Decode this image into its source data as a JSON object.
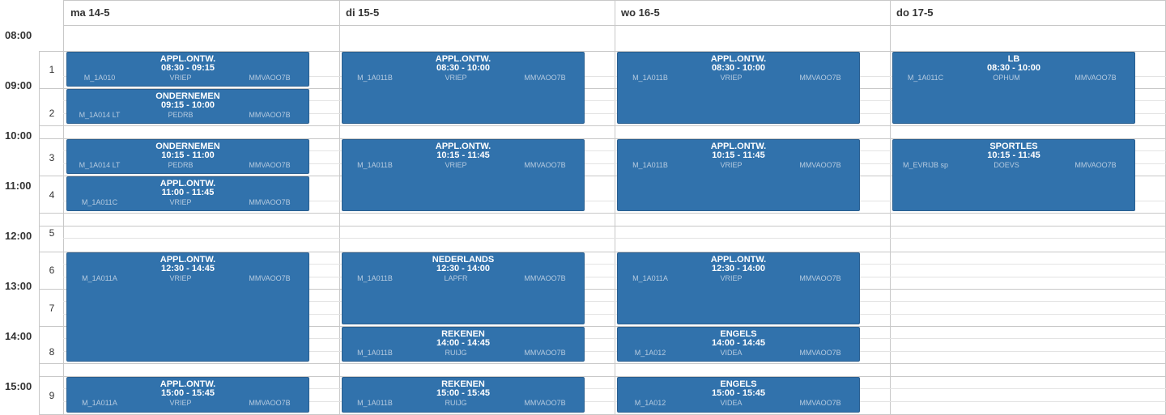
{
  "days": [
    {
      "label": "ma 14-5"
    },
    {
      "label": "di 15-5"
    },
    {
      "label": "wo 16-5"
    },
    {
      "label": "do 17-5"
    }
  ],
  "times": [
    "08:00",
    "09:00",
    "10:00",
    "11:00",
    "12:00",
    "13:00",
    "14:00",
    "15:00"
  ],
  "periods": [
    "1",
    "2",
    "3",
    "4",
    "5",
    "6",
    "7",
    "8",
    "9"
  ],
  "events": [
    {
      "day": 0,
      "title": "APPL.ONTW.",
      "time": "08:30 - 09:15",
      "room": "M_1A010",
      "teacher": "VRIEP",
      "group": "MMVAOO7B"
    },
    {
      "day": 0,
      "title": "ONDERNEMEN",
      "time": "09:15 - 10:00",
      "room": "M_1A014 LT",
      "teacher": "PEDRB",
      "group": "MMVAOO7B"
    },
    {
      "day": 0,
      "title": "ONDERNEMEN",
      "time": "10:15 - 11:00",
      "room": "M_1A014 LT",
      "teacher": "PEDRB",
      "group": "MMVAOO7B"
    },
    {
      "day": 0,
      "title": "APPL.ONTW.",
      "time": "11:00 - 11:45",
      "room": "M_1A011C",
      "teacher": "VRIEP",
      "group": "MMVAOO7B"
    },
    {
      "day": 0,
      "title": "APPL.ONTW.",
      "time": "12:30 - 14:45",
      "room": "M_1A011A",
      "teacher": "VRIEP",
      "group": "MMVAOO7B"
    },
    {
      "day": 0,
      "title": "APPL.ONTW.",
      "time": "15:00 - 15:45",
      "room": "M_1A011A",
      "teacher": "VRIEP",
      "group": "MMVAOO7B"
    },
    {
      "day": 1,
      "title": "APPL.ONTW.",
      "time": "08:30 - 10:00",
      "room": "M_1A011B",
      "teacher": "VRIEP",
      "group": "MMVAOO7B"
    },
    {
      "day": 1,
      "title": "APPL.ONTW.",
      "time": "10:15 - 11:45",
      "room": "M_1A011B",
      "teacher": "VRIEP",
      "group": "MMVAOO7B"
    },
    {
      "day": 1,
      "title": "NEDERLANDS",
      "time": "12:30 - 14:00",
      "room": "M_1A011B",
      "teacher": "LAPFR",
      "group": "MMVAOO7B"
    },
    {
      "day": 1,
      "title": "REKENEN",
      "time": "14:00 - 14:45",
      "room": "M_1A011B",
      "teacher": "RUIJG",
      "group": "MMVAOO7B"
    },
    {
      "day": 1,
      "title": "REKENEN",
      "time": "15:00 - 15:45",
      "room": "M_1A011B",
      "teacher": "RUIJG",
      "group": "MMVAOO7B"
    },
    {
      "day": 2,
      "title": "APPL.ONTW.",
      "time": "08:30 - 10:00",
      "room": "M_1A011B",
      "teacher": "VRIEP",
      "group": "MMVAOO7B"
    },
    {
      "day": 2,
      "title": "APPL.ONTW.",
      "time": "10:15 - 11:45",
      "room": "M_1A011B",
      "teacher": "VRIEP",
      "group": "MMVAOO7B"
    },
    {
      "day": 2,
      "title": "APPL.ONTW.",
      "time": "12:30 - 14:00",
      "room": "M_1A011A",
      "teacher": "VRIEP",
      "group": "MMVAOO7B"
    },
    {
      "day": 2,
      "title": "ENGELS",
      "time": "14:00 - 14:45",
      "room": "M_1A012",
      "teacher": "VIDEA",
      "group": "MMVAOO7B"
    },
    {
      "day": 2,
      "title": "ENGELS",
      "time": "15:00 - 15:45",
      "room": "M_1A012",
      "teacher": "VIDEA",
      "group": "MMVAOO7B"
    },
    {
      "day": 3,
      "title": "LB",
      "time": "08:30 - 10:00",
      "room": "M_1A011C",
      "teacher": "OPHUM",
      "group": "MMVAOO7B"
    },
    {
      "day": 3,
      "title": "SPORTLES",
      "time": "10:15 - 11:45",
      "room": "M_EVRIJB sp",
      "teacher": "DOEVS",
      "group": "MMVAOO7B"
    }
  ]
}
